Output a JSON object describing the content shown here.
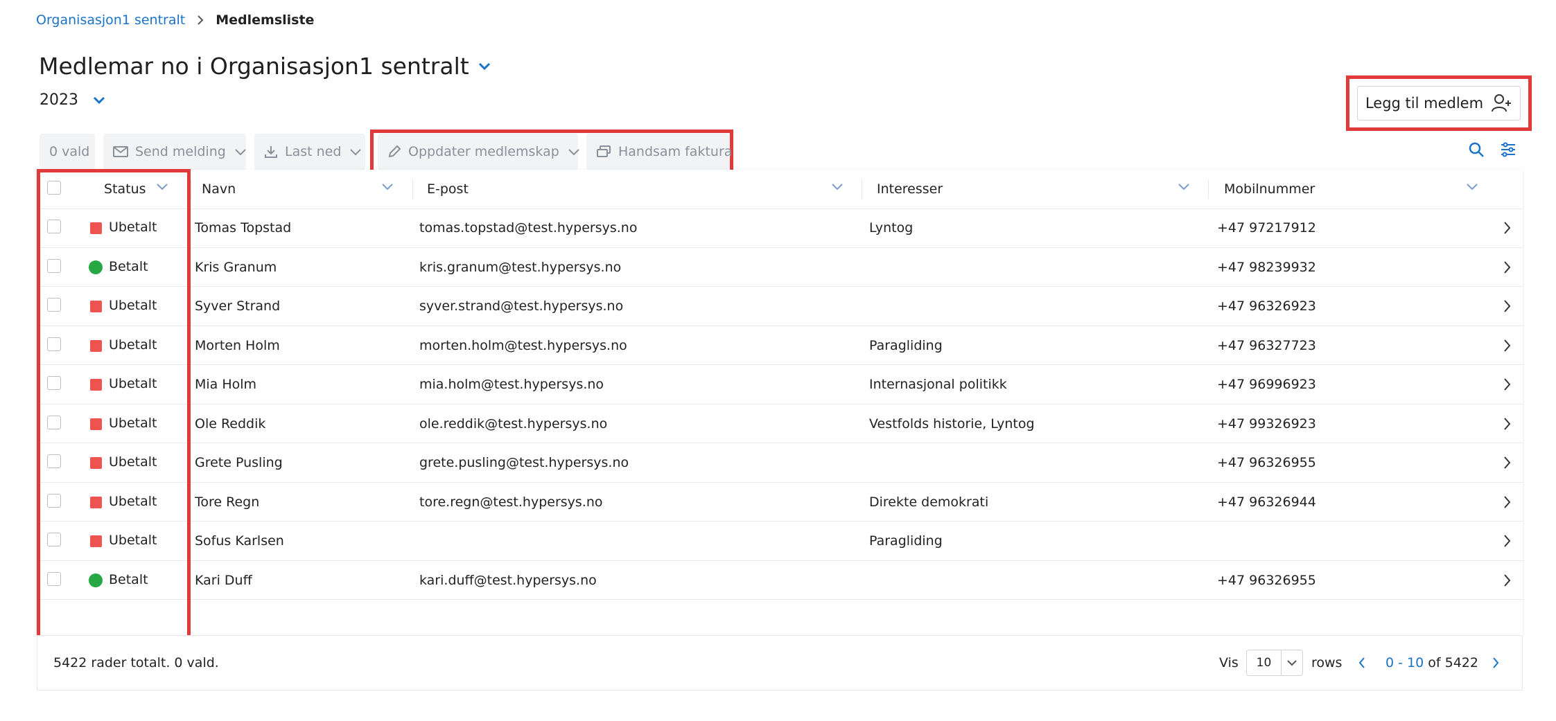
{
  "breadcrumb": {
    "parent": "Organisasjon1 sentralt",
    "current": "Medlemsliste"
  },
  "page": {
    "title": "Medlemar no i Organisasjon1 sentralt",
    "year": "2023"
  },
  "actions": {
    "add_member": "Legg til medlem"
  },
  "toolbar": {
    "selected": "0 vald",
    "send_message": "Send melding",
    "download": "Last ned",
    "update_membership": "Oppdater medlemskap",
    "handle_invoice": "Handsam faktura"
  },
  "table": {
    "headers": {
      "status": "Status",
      "name": "Navn",
      "email": "E-post",
      "interests": "Interesser",
      "mobile": "Mobilnummer"
    },
    "rows": [
      {
        "status": "Ubetalt",
        "paid": false,
        "name": "Tomas Topstad",
        "email": "tomas.topstad@test.hypersys.no",
        "interests": "Lyntog",
        "mobile": "+47 97217912"
      },
      {
        "status": "Betalt",
        "paid": true,
        "name": "Kris Granum",
        "email": "kris.granum@test.hypersys.no",
        "interests": "",
        "mobile": "+47 98239932"
      },
      {
        "status": "Ubetalt",
        "paid": false,
        "name": "Syver Strand",
        "email": "syver.strand@test.hypersys.no",
        "interests": "",
        "mobile": "+47 96326923"
      },
      {
        "status": "Ubetalt",
        "paid": false,
        "name": "Morten Holm",
        "email": "morten.holm@test.hypersys.no",
        "interests": "Paragliding",
        "mobile": "+47 96327723"
      },
      {
        "status": "Ubetalt",
        "paid": false,
        "name": "Mia Holm",
        "email": "mia.holm@test.hypersys.no",
        "interests": "Internasjonal politikk",
        "mobile": "+47 96996923"
      },
      {
        "status": "Ubetalt",
        "paid": false,
        "name": "Ole Reddik",
        "email": "ole.reddik@test.hypersys.no",
        "interests": "Vestfolds historie, Lyntog",
        "mobile": "+47 99326923"
      },
      {
        "status": "Ubetalt",
        "paid": false,
        "name": "Grete Pusling",
        "email": "grete.pusling@test.hypersys.no",
        "interests": "",
        "mobile": "+47 96326955"
      },
      {
        "status": "Ubetalt",
        "paid": false,
        "name": "Tore Regn",
        "email": "tore.regn@test.hypersys.no",
        "interests": "Direkte demokrati",
        "mobile": "+47 96326944"
      },
      {
        "status": "Ubetalt",
        "paid": false,
        "name": "Sofus Karlsen",
        "email": "",
        "interests": "Paragliding",
        "mobile": ""
      },
      {
        "status": "Betalt",
        "paid": true,
        "name": "Kari Duff",
        "email": "kari.duff@test.hypersys.no",
        "interests": "",
        "mobile": "+47 96326955"
      }
    ]
  },
  "footer": {
    "total": "5422 rader totalt. 0 vald.",
    "show_label": "Vis",
    "rows_per_page": "10",
    "rows_label": "rows",
    "range": "0 - 10",
    "of_label": "of 5422"
  },
  "colors": {
    "accent": "#1a73c9",
    "unpaid": "#ef5350",
    "paid": "#28a745",
    "highlight": "#e03a3a"
  },
  "icons": [
    "chevron-right-icon",
    "chevron-down-icon",
    "add-user-icon",
    "mail-icon",
    "download-icon",
    "pencil-icon",
    "invoice-icon",
    "search-icon",
    "filter-sliders-icon"
  ]
}
